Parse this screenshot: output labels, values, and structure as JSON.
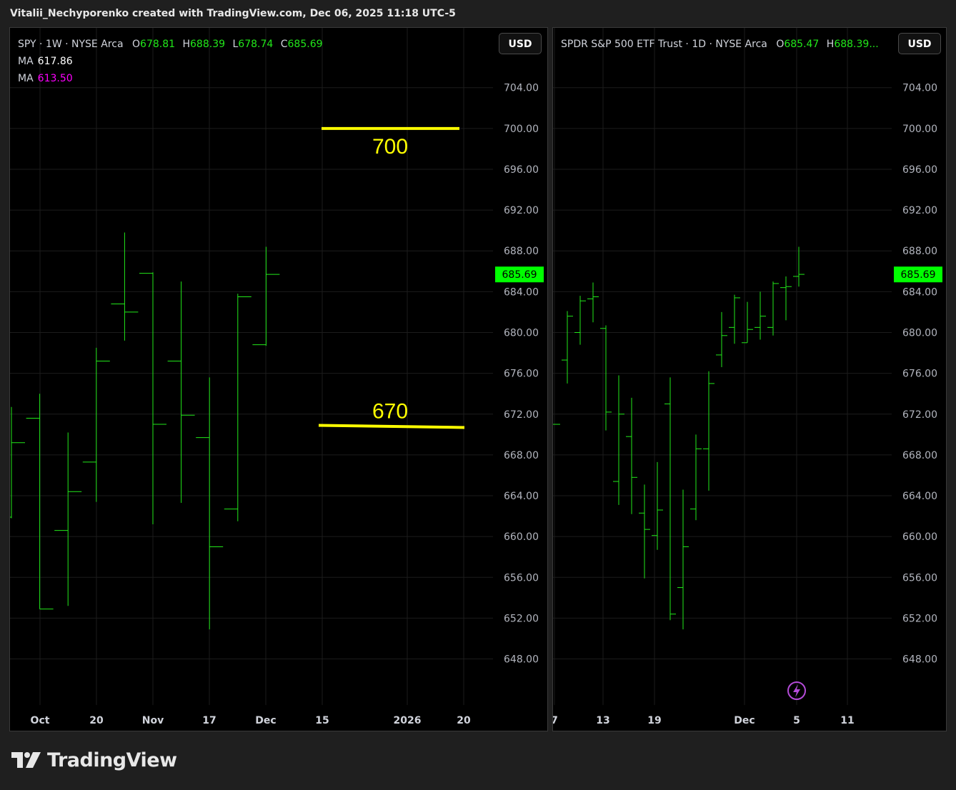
{
  "caption": "Vitalii_Nechyporenko created with TradingView.com, Dec 06, 2025 11:18 UTC-5",
  "brand": {
    "name": "TradingView",
    "logo_icon": "tradingview-logo-icon"
  },
  "colors": {
    "up": "#22e81a",
    "background": "#000000",
    "annotation": "#ffff00",
    "price_label_bg": "#00ff00",
    "ma1": "#ffffff",
    "ma2": "#ff00ff",
    "lightning": "#b44bd8"
  },
  "left": {
    "legend": {
      "symbol": "SPY · 1W · NYSE Arca",
      "o_label": "O",
      "o": "678.81",
      "h_label": "H",
      "h": "688.39",
      "l_label": "L",
      "l": "678.74",
      "c_label": "C",
      "c": "685.69"
    },
    "ma1": {
      "label": "MA",
      "value": "617.86"
    },
    "ma2": {
      "label": "MA",
      "value": "613.50"
    },
    "currency": "USD",
    "last_price": "685.69",
    "annotations": [
      {
        "text": "700",
        "price": 700
      },
      {
        "text": "670",
        "price": 670.9
      }
    ],
    "x_ticks": [
      "Oct",
      "20",
      "Nov",
      "17",
      "Dec",
      "15",
      "2026",
      "20"
    ]
  },
  "right": {
    "legend": {
      "symbol": "SPDR S&P 500 ETF Trust · 1D · NYSE Arca",
      "o_label": "O",
      "o": "685.47",
      "h_label": "H",
      "h": "688.39..."
    },
    "currency": "USD",
    "last_price": "685.69",
    "x_ticks": [
      "7",
      "13",
      "19",
      "Dec",
      "5",
      "11"
    ]
  },
  "chart_data": [
    {
      "type": "ohlc",
      "title": "SPY · 1W · NYSE Arca",
      "timeframe": "1W",
      "ylim": [
        645,
        706.5
      ],
      "y_ticks": [
        648,
        652,
        656,
        660,
        664,
        668,
        672,
        676,
        680,
        684,
        688,
        692,
        696,
        700,
        704
      ],
      "x_labels": [
        "Oct",
        "20",
        "Nov",
        "17",
        "Dec",
        "15",
        "2026",
        "20"
      ],
      "grid": true,
      "series": [
        {
          "o": 661.9,
          "h": 672.7,
          "l": 661.8,
          "c": 669.2
        },
        {
          "o": 671.6,
          "h": 674.0,
          "l": 652.9,
          "c": 652.9
        },
        {
          "o": 660.6,
          "h": 670.2,
          "l": 653.2,
          "c": 664.4
        },
        {
          "o": 667.3,
          "h": 678.5,
          "l": 663.4,
          "c": 677.2
        },
        {
          "o": 682.8,
          "h": 689.8,
          "l": 679.2,
          "c": 682.0
        },
        {
          "o": 685.8,
          "h": 685.9,
          "l": 661.2,
          "c": 671.0
        },
        {
          "o": 677.2,
          "h": 685.0,
          "l": 663.3,
          "c": 671.9
        },
        {
          "o": 669.7,
          "h": 675.6,
          "l": 650.9,
          "c": 659.0
        },
        {
          "o": 662.7,
          "h": 683.8,
          "l": 661.5,
          "c": 683.5
        },
        {
          "o": 678.8,
          "h": 688.4,
          "l": 678.7,
          "c": 685.7
        }
      ]
    },
    {
      "type": "ohlc",
      "title": "SPDR S&P 500 ETF Trust · 1D · NYSE Arca",
      "timeframe": "1D",
      "ylim": [
        645,
        706.5
      ],
      "y_ticks": [
        648,
        652,
        656,
        660,
        664,
        668,
        672,
        676,
        680,
        684,
        688,
        692,
        696,
        700,
        704
      ],
      "x_labels": [
        "7",
        "13",
        "19",
        "Dec",
        "5",
        "11"
      ],
      "grid": true,
      "series": [
        {
          "o": 671.0,
          "h": 671.0,
          "l": 671.0,
          "c": 671.0
        },
        {
          "o": 677.3,
          "h": 682.1,
          "l": 675.0,
          "c": 681.6
        },
        {
          "o": 680.0,
          "h": 683.6,
          "l": 678.8,
          "c": 683.1
        },
        {
          "o": 683.3,
          "h": 684.9,
          "l": 681.0,
          "c": 683.5
        },
        {
          "o": 680.4,
          "h": 680.7,
          "l": 670.4,
          "c": 672.2
        },
        {
          "o": 665.4,
          "h": 675.8,
          "l": 663.1,
          "c": 672.0
        },
        {
          "o": 669.8,
          "h": 673.6,
          "l": 662.2,
          "c": 665.8
        },
        {
          "o": 662.3,
          "h": 665.1,
          "l": 655.9,
          "c": 660.7
        },
        {
          "o": 660.1,
          "h": 667.3,
          "l": 658.7,
          "c": 662.6
        },
        {
          "o": 673.0,
          "h": 675.6,
          "l": 651.8,
          "c": 652.4
        },
        {
          "o": 655.0,
          "h": 664.6,
          "l": 650.9,
          "c": 659.0
        },
        {
          "o": 662.7,
          "h": 670.0,
          "l": 661.6,
          "c": 668.6
        },
        {
          "o": 668.6,
          "h": 676.2,
          "l": 664.5,
          "c": 675.0
        },
        {
          "o": 677.8,
          "h": 682.0,
          "l": 676.6,
          "c": 679.7
        },
        {
          "o": 680.5,
          "h": 683.7,
          "l": 678.9,
          "c": 683.4
        },
        {
          "o": 679.0,
          "h": 683.0,
          "l": 679.0,
          "c": 680.3
        },
        {
          "o": 680.5,
          "h": 684.0,
          "l": 679.3,
          "c": 681.6
        },
        {
          "o": 680.5,
          "h": 685.0,
          "l": 679.7,
          "c": 684.8
        },
        {
          "o": 684.4,
          "h": 685.5,
          "l": 681.2,
          "c": 684.5
        },
        {
          "o": 685.5,
          "h": 688.4,
          "l": 684.5,
          "c": 685.7
        }
      ]
    }
  ]
}
